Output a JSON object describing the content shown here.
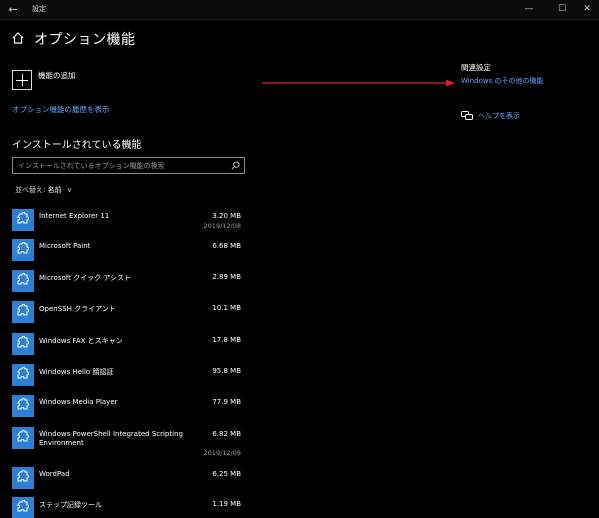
{
  "window": {
    "title": "設定",
    "back_icon": "←",
    "minimize": "—",
    "maximize": "☐",
    "close": "✕"
  },
  "header": {
    "title": "オプション機能"
  },
  "add_feature": {
    "label": "機能の追加"
  },
  "history_link": "オプション機能の履歴を表示",
  "installed": {
    "title": "インストールされている機能",
    "search_placeholder": "インストールされているオプション機能の検索",
    "sort_label": "並べ替え:",
    "sort_value": "名前",
    "items": [
      {
        "name": "Internet Explorer 11",
        "size": "3.20 MB",
        "date": "2019/12/08"
      },
      {
        "name": "Microsoft Paint",
        "size": "6.68 MB",
        "date": ""
      },
      {
        "name": "Microsoft クイック アシスト",
        "size": "2.89 MB",
        "date": ""
      },
      {
        "name": "OpenSSH クライアント",
        "size": "10.1 MB",
        "date": ""
      },
      {
        "name": "Windows FAX とスキャン",
        "size": "17.8 MB",
        "date": ""
      },
      {
        "name": "Windows Hello 顔認証",
        "size": "95.8 MB",
        "date": ""
      },
      {
        "name": "Windows Media Player",
        "size": "77.9 MB",
        "date": ""
      },
      {
        "name": "Windows PowerShell Integrated Scripting",
        "name2": "Environment",
        "size": "6.82 MB",
        "date": "2019/12/08"
      },
      {
        "name": "WordPad",
        "size": "6.25 MB",
        "date": ""
      },
      {
        "name": "ステップ記録ツール",
        "size": "1.19 MB",
        "date": ""
      }
    ]
  },
  "related": {
    "title": "関連設定",
    "link": "Windows のその他の機能",
    "help": "ヘルプを表示"
  },
  "colors": {
    "accent_link": "#5da6ff",
    "icon_tile": "#2b7fd4",
    "annotation_arrow": "#e0241b"
  }
}
